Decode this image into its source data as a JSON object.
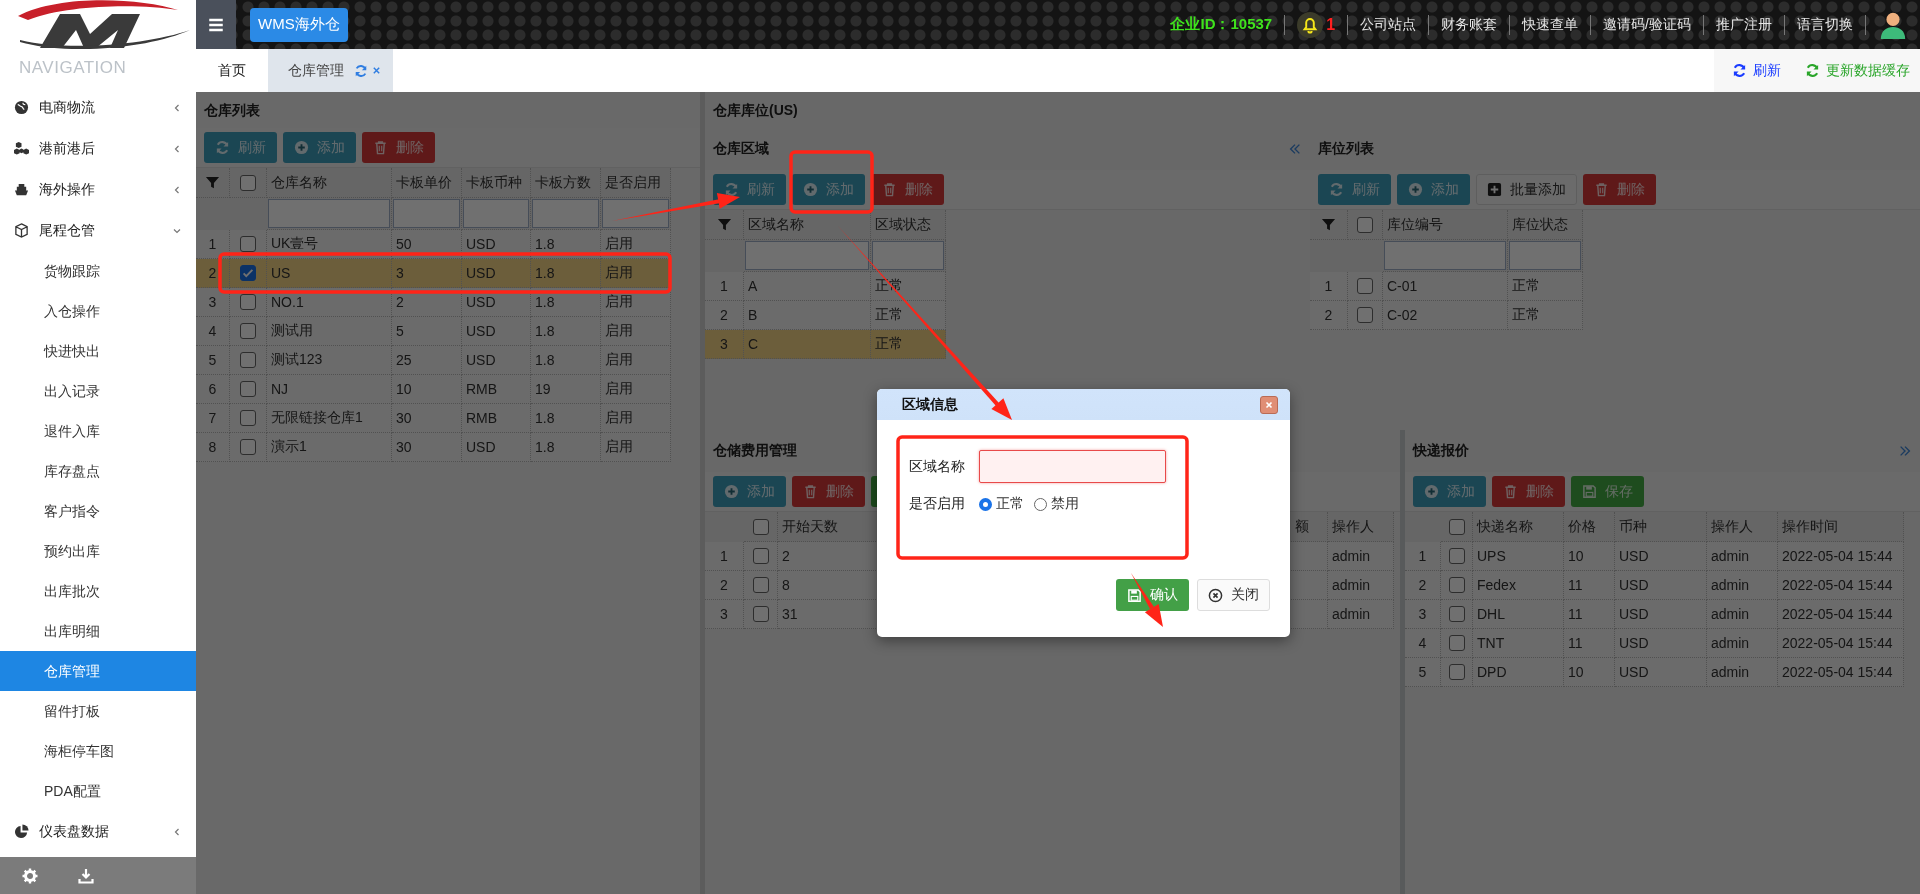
{
  "header": {
    "brand": "WMS海外仓",
    "company_id": "企业ID：10537",
    "notification_count": "1",
    "links": [
      "公司站点",
      "财务账套",
      "快速查单",
      "邀请码/验证码",
      "推广注册",
      "语言切换"
    ]
  },
  "sidebar": {
    "heading": "NAVIGATION",
    "items": [
      {
        "label": "电商物流",
        "kind": "globe",
        "expanded": false
      },
      {
        "label": "港前港后",
        "kind": "cubes",
        "expanded": false
      },
      {
        "label": "海外操作",
        "kind": "ship",
        "expanded": false
      },
      {
        "label": "尾程仓管",
        "kind": "cube",
        "expanded": true,
        "children": [
          {
            "label": "货物跟踪",
            "selected": false
          },
          {
            "label": "入仓操作",
            "selected": false
          },
          {
            "label": "快进快出",
            "selected": false
          },
          {
            "label": "出入记录",
            "selected": false
          },
          {
            "label": "退件入库",
            "selected": false
          },
          {
            "label": "库存盘点",
            "selected": false
          },
          {
            "label": "客户指令",
            "selected": false
          },
          {
            "label": "预约出库",
            "selected": false
          },
          {
            "label": "出库批次",
            "selected": false
          },
          {
            "label": "出库明细",
            "selected": false
          },
          {
            "label": "仓库管理",
            "selected": true
          },
          {
            "label": "留件打板",
            "selected": false
          },
          {
            "label": "海柜停车图",
            "selected": false
          },
          {
            "label": "PDA配置",
            "selected": false
          }
        ]
      },
      {
        "label": "仪表盘数据",
        "kind": "pie",
        "expanded": false
      }
    ]
  },
  "tabs": [
    {
      "label": "首页",
      "selected": false,
      "closable": false
    },
    {
      "label": "仓库管理",
      "selected": true,
      "closable": true
    }
  ],
  "tab_actions": [
    {
      "label": "刷新",
      "color": "#1a3cff"
    },
    {
      "label": "更新数据缓存",
      "color": "#2aa52a"
    }
  ],
  "warehouse_list": {
    "title": "仓库列表",
    "buttons": [
      {
        "label": "刷新",
        "kind": "refresh"
      },
      {
        "label": "添加",
        "kind": "add"
      },
      {
        "label": "删除",
        "kind": "delete"
      }
    ],
    "columns": [
      "仓库名称",
      "卡板单价",
      "卡板币种",
      "卡板方数",
      "是否启用"
    ],
    "all_checked": false,
    "rows": [
      {
        "index": "1",
        "checked": false,
        "selected": false,
        "cells": [
          "UK壹号",
          "50",
          "USD",
          "1.8",
          "启用"
        ]
      },
      {
        "index": "2",
        "checked": true,
        "selected": true,
        "cells": [
          "US",
          "3",
          "USD",
          "1.8",
          "启用"
        ]
      },
      {
        "index": "3",
        "checked": false,
        "selected": false,
        "cells": [
          "NO.1",
          "2",
          "USD",
          "1.8",
          "启用"
        ]
      },
      {
        "index": "4",
        "checked": false,
        "selected": false,
        "cells": [
          "测试用",
          "5",
          "USD",
          "1.8",
          "启用"
        ]
      },
      {
        "index": "5",
        "checked": false,
        "selected": false,
        "cells": [
          "测试123",
          "25",
          "USD",
          "1.8",
          "启用"
        ]
      },
      {
        "index": "6",
        "checked": false,
        "selected": false,
        "cells": [
          "NJ",
          "10",
          "RMB",
          "19",
          "启用"
        ]
      },
      {
        "index": "7",
        "checked": false,
        "selected": false,
        "cells": [
          "无限链接仓库1",
          "30",
          "RMB",
          "1.8",
          "启用"
        ]
      },
      {
        "index": "8",
        "checked": false,
        "selected": false,
        "cells": [
          "演示1",
          "30",
          "USD",
          "1.8",
          "启用"
        ]
      }
    ]
  },
  "warehouse_slots": {
    "title": "仓库库位(US)",
    "zones": {
      "title": "仓库区域",
      "buttons": [
        {
          "label": "刷新",
          "kind": "refresh"
        },
        {
          "label": "添加",
          "kind": "add"
        },
        {
          "label": "删除",
          "kind": "delete"
        }
      ],
      "columns": [
        "区域名称",
        "区域状态"
      ],
      "rows": [
        {
          "index": "1",
          "selected": false,
          "cells": [
            "A",
            "正常"
          ]
        },
        {
          "index": "2",
          "selected": false,
          "cells": [
            "B",
            "正常"
          ]
        },
        {
          "index": "3",
          "selected": true,
          "cells": [
            "C",
            "正常"
          ]
        }
      ]
    },
    "locations": {
      "title": "库位列表",
      "buttons": [
        {
          "label": "刷新",
          "kind": "refresh"
        },
        {
          "label": "添加",
          "kind": "add"
        },
        {
          "label": "批量添加",
          "kind": "batch_add"
        },
        {
          "label": "删除",
          "kind": "delete"
        }
      ],
      "columns": [
        "库位编号",
        "库位状态"
      ],
      "all_checked": false,
      "rows": [
        {
          "index": "1",
          "checked": false,
          "selected": false,
          "cells": [
            "C-01",
            "正常"
          ]
        },
        {
          "index": "2",
          "checked": false,
          "selected": false,
          "cells": [
            "C-02",
            "正常"
          ]
        }
      ]
    },
    "storage_fees": {
      "title": "仓储费用管理",
      "buttons": [
        {
          "label": "添加",
          "kind": "add"
        },
        {
          "label": "删除",
          "kind": "delete"
        },
        {
          "kind": "save"
        }
      ],
      "columns": [
        "开始天数",
        "额",
        "操作人"
      ],
      "all_checked": false,
      "rows": [
        {
          "index": "1",
          "checked": false,
          "selected": false,
          "cells": [
            "2",
            "admin"
          ]
        },
        {
          "index": "2",
          "checked": false,
          "selected": false,
          "cells": [
            "8",
            "admin"
          ]
        },
        {
          "index": "3",
          "checked": false,
          "selected": false,
          "cells": [
            "31",
            "admin"
          ]
        }
      ]
    },
    "express_quotes": {
      "title": "快递报价",
      "buttons": [
        {
          "label": "添加",
          "kind": "add"
        },
        {
          "label": "删除",
          "kind": "delete"
        },
        {
          "label": "保存",
          "kind": "save"
        }
      ],
      "columns": [
        "快递名称",
        "价格",
        "币种",
        "操作人",
        "操作时间"
      ],
      "all_checked": false,
      "rows": [
        {
          "index": "1",
          "checked": false,
          "selected": false,
          "cells": [
            "UPS",
            "10",
            "USD",
            "admin",
            "2022-05-04 15:44"
          ]
        },
        {
          "index": "2",
          "checked": false,
          "selected": false,
          "cells": [
            "Fedex",
            "11",
            "USD",
            "admin",
            "2022-05-04 15:44"
          ]
        },
        {
          "index": "3",
          "checked": false,
          "selected": false,
          "cells": [
            "DHL",
            "11",
            "USD",
            "admin",
            "2022-05-04 15:44"
          ]
        },
        {
          "index": "4",
          "checked": false,
          "selected": false,
          "cells": [
            "TNT",
            "11",
            "USD",
            "admin",
            "2022-05-04 15:44"
          ]
        },
        {
          "index": "5",
          "checked": false,
          "selected": false,
          "cells": [
            "DPD",
            "10",
            "USD",
            "admin",
            "2022-05-04 15:44"
          ]
        }
      ]
    }
  },
  "dialog": {
    "title": "区域信息",
    "name_field": {
      "label": "区域名称",
      "invalid": true
    },
    "status_field": {
      "label": "是否启用",
      "options": [
        {
          "label": "正常",
          "selected": true
        },
        {
          "label": "禁用",
          "selected": false
        }
      ]
    },
    "buttons": [
      {
        "label": "确认",
        "kind": "confirm"
      },
      {
        "label": "关闭",
        "kind": "close"
      }
    ]
  }
}
